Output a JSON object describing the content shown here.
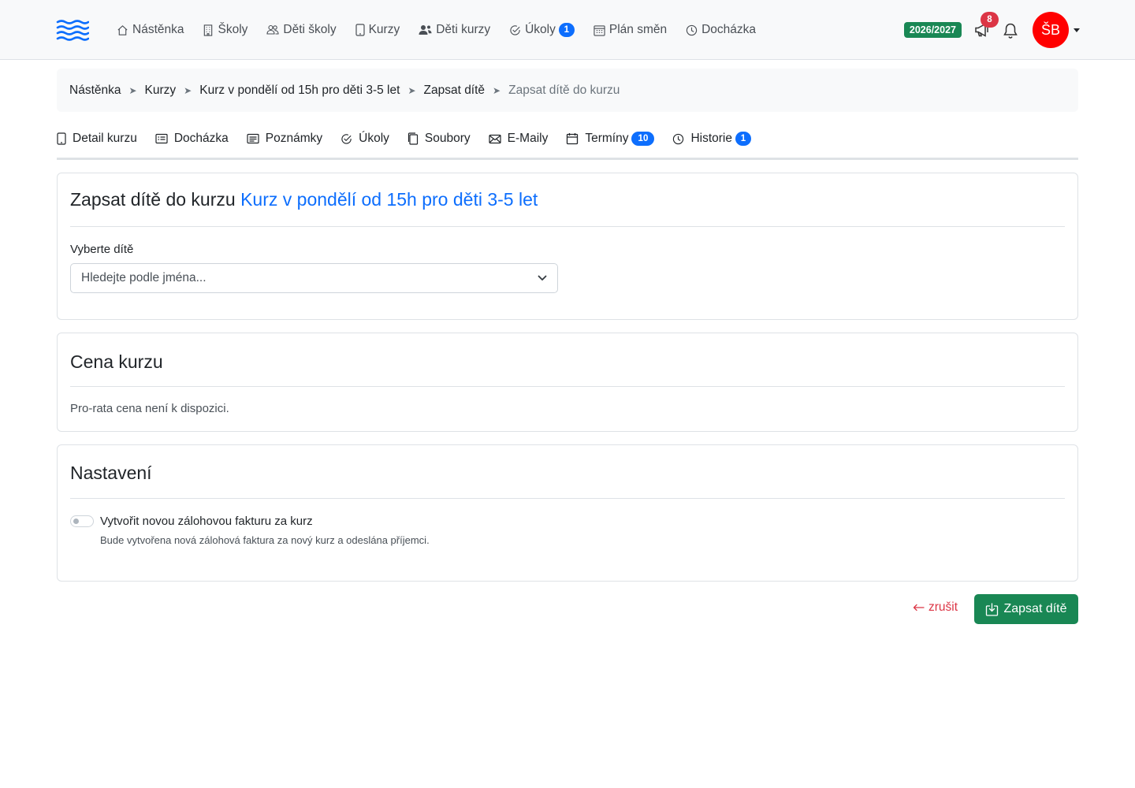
{
  "nav": {
    "links": [
      {
        "label": "Nástěnka",
        "icon": "house-icon"
      },
      {
        "label": "Školy",
        "icon": "building-icon"
      },
      {
        "label": "Děti školy",
        "icon": "people-icon"
      },
      {
        "label": "Kurzy",
        "icon": "tablet-icon"
      },
      {
        "label": "Děti kurzy",
        "icon": "people-fill-icon"
      },
      {
        "label": "Úkoly",
        "icon": "check-circle-icon",
        "badge": "1"
      },
      {
        "label": "Plán směn",
        "icon": "calendar-grid-icon"
      },
      {
        "label": "Docházka",
        "icon": "clock-icon"
      }
    ],
    "year": "2026/2027",
    "announcements_count": "8",
    "avatar_initials": "ŠB"
  },
  "breadcrumb": {
    "items": [
      "Nástěnka",
      "Kurzy",
      "Kurz v pondělí od 15h pro děti 3-5 let",
      "Zapsat dítě"
    ],
    "active": "Zapsat dítě do kurzu",
    "separator": "➤"
  },
  "tabs": [
    {
      "label": "Detail kurzu",
      "icon": "tablet-icon"
    },
    {
      "label": "Docházka",
      "icon": "card-list-icon"
    },
    {
      "label": "Poznámky",
      "icon": "notes-icon"
    },
    {
      "label": "Úkoly",
      "icon": "check-circle-icon"
    },
    {
      "label": "Soubory",
      "icon": "files-icon"
    },
    {
      "label": "E-Maily",
      "icon": "envelope-icon"
    },
    {
      "label": "Termíny",
      "icon": "calendar-icon",
      "badge": "10"
    },
    {
      "label": "Historie",
      "icon": "clock-icon",
      "badge": "1"
    }
  ],
  "enroll_card": {
    "title_prefix": "Zapsat dítě do kurzu",
    "course_link": "Kurz v pondělí od 15h pro děti 3-5 let",
    "select_label": "Vyberte dítě",
    "select_placeholder": "Hledejte podle jména..."
  },
  "price_card": {
    "title": "Cena kurzu",
    "text": "Pro-rata cena není k dispozici."
  },
  "settings_card": {
    "title": "Nastavení",
    "switch_label": "Vytvořit novou zálohovou fakturu za kurz",
    "switch_checked": false,
    "help_text": "Bude vytvořena nová zálohová faktura za nový kurz a odeslána příjemci."
  },
  "actions": {
    "cancel_label": "zrušit",
    "submit_label": "Zapsat dítě"
  },
  "colors": {
    "primary": "#0d6efd",
    "success": "#198754",
    "danger": "#dc3545",
    "avatar": "#ff0000"
  }
}
